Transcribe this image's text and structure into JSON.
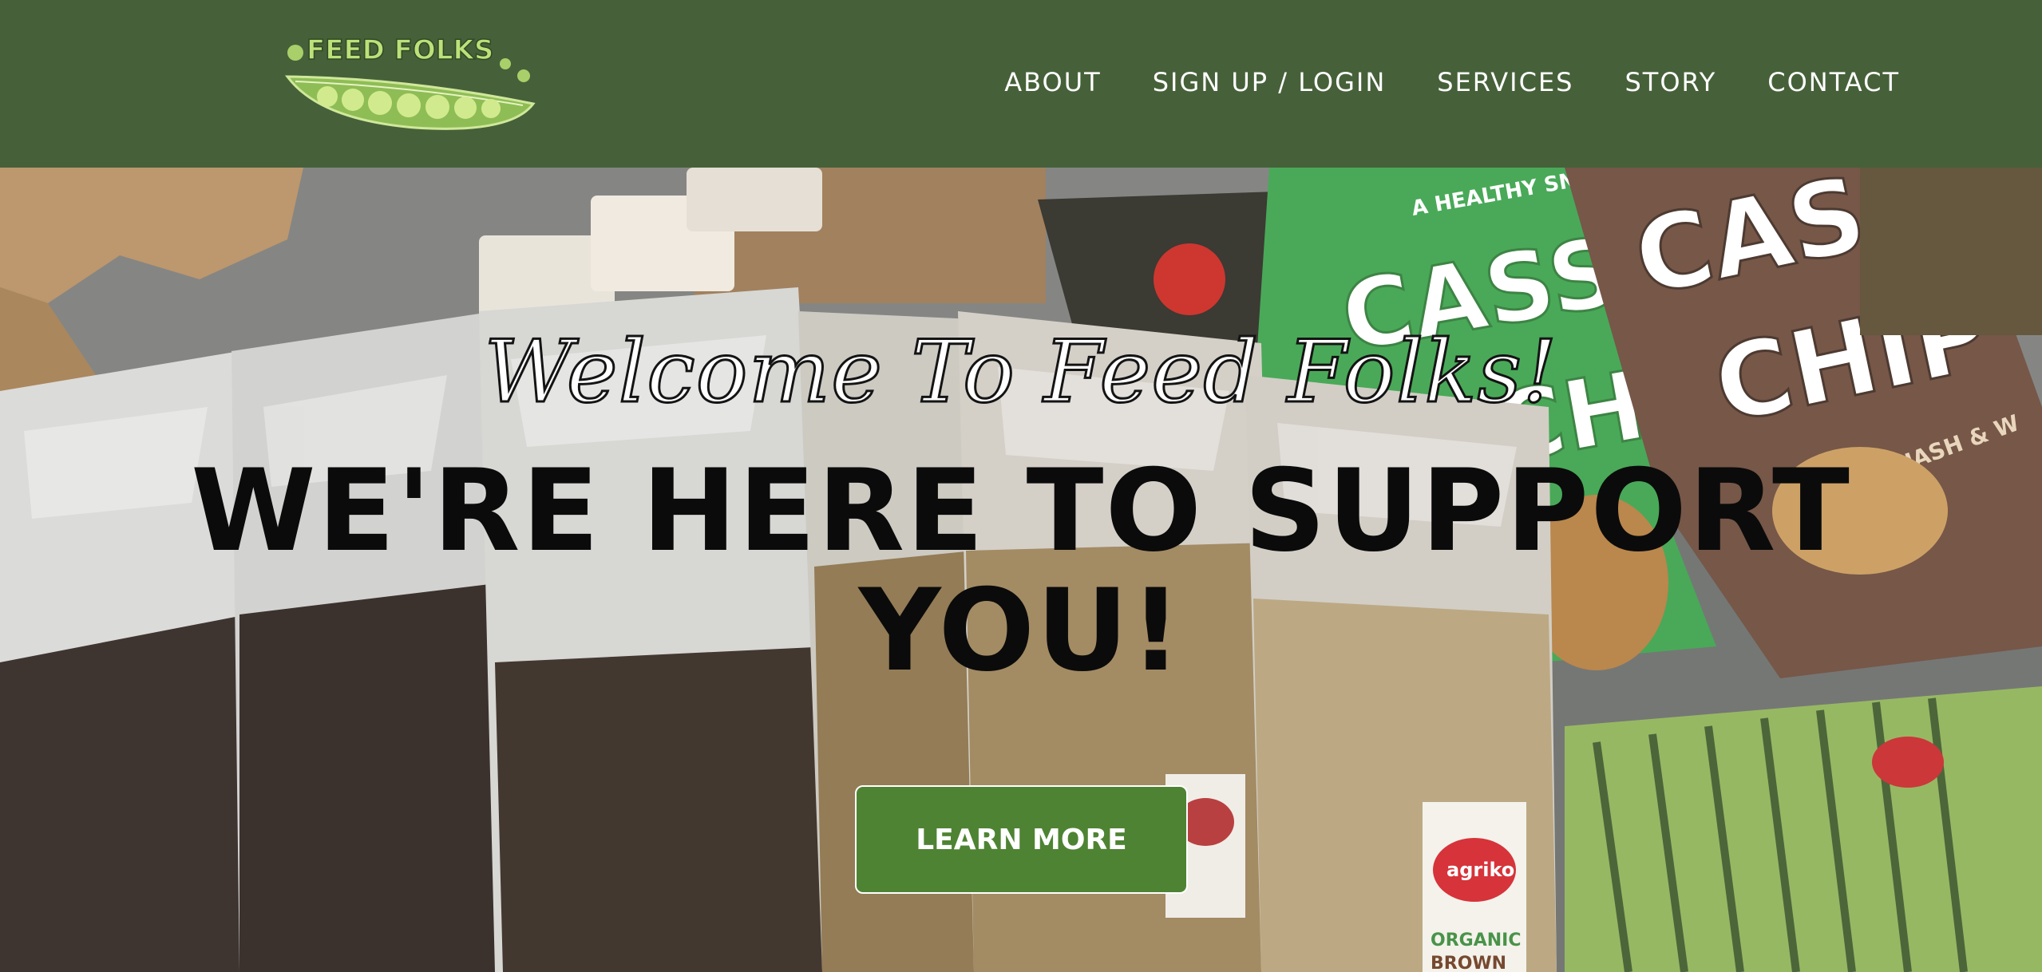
{
  "brand": {
    "name": "FEED FOLKS",
    "logo_icon": "pea-pod-logo"
  },
  "nav": {
    "items": [
      {
        "label": "ABOUT"
      },
      {
        "label": "SIGN UP / LOGIN"
      },
      {
        "label": "SERVICES"
      },
      {
        "label": "STORY"
      },
      {
        "label": "CONTACT"
      }
    ]
  },
  "hero": {
    "welcome": "Welcome To Feed Folks!",
    "headline": "WE'RE HERE TO SUPPORT YOU!",
    "cta_label": "LEARN MORE",
    "product_labels": {
      "bag_slogan": "A HEALTHY SNACK",
      "bag1_title": "CASSA",
      "bag1_sub": "CHIP",
      "bag2_title": "CASSA",
      "bag2_sub": "CHIP",
      "bag2_flavor": "WITH SQUASH & W",
      "brand": "agriko",
      "organic": "ORGANIC",
      "brown": "BROWN"
    }
  },
  "colors": {
    "header_bg": "#466139",
    "cta_bg": "#4e8333",
    "logo_text": "#bde07a"
  }
}
